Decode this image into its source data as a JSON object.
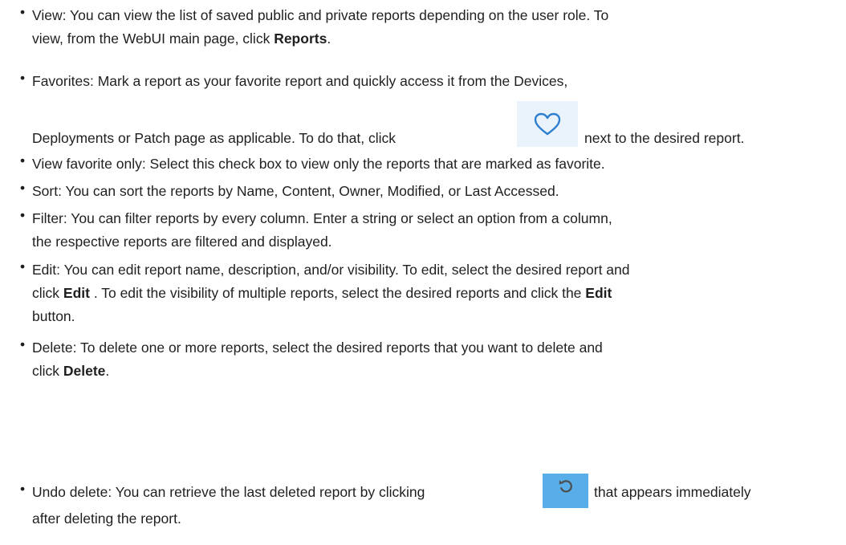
{
  "bullet_char": "•",
  "items": [
    {
      "lines": [
        [
          "View: You can view the list of saved public and private reports depending on the user role. To"
        ],
        [
          "view, from the WebUI main page, click ",
          {
            "b": "Reports"
          },
          "."
        ]
      ]
    },
    {
      "lines": [
        [
          "Favorites: Mark a report as your favorite report and quickly access it from the Devices,"
        ],
        [
          "Deployments or Patch page as applicable. To do that, click "
        ],
        [
          "next to the desired report."
        ]
      ]
    },
    {
      "lines": [
        [
          "View favorite only: Select this check box to view only the reports that are marked as favorite."
        ]
      ]
    },
    {
      "lines": [
        [
          "Sort: You can sort the reports by Name, Content, Owner, Modified, or Last Accessed."
        ]
      ]
    },
    {
      "lines": [
        [
          "Filter: You can filter reports by every column. Enter a string or select an option from a column,"
        ],
        [
          "the respective reports are filtered and displayed."
        ]
      ]
    },
    {
      "lines": [
        [
          "Edit: You can edit report name, description, and/or visibility. To edit, select the desired report and"
        ],
        [
          "click ",
          {
            "b": "Edit"
          },
          " . To edit the visibility of multiple reports, select the desired reports and click the ",
          {
            "b": "Edit"
          }
        ],
        [
          "button."
        ]
      ]
    },
    {
      "lines": [
        [
          "Delete: To delete one or more reports, select the desired reports that you want to delete and"
        ],
        [
          "click ",
          {
            "b": "Delete"
          },
          "."
        ]
      ]
    },
    {
      "lines": [
        [
          "Undo delete: You can retrieve the last deleted report by clicking "
        ],
        [
          "that appears immediately"
        ],
        [
          "after deleting the report."
        ]
      ]
    }
  ],
  "icons": {
    "favorite": "heart-icon",
    "undo": "undo-icon"
  },
  "colors": {
    "text": "#1f1f1f",
    "heart_bg": "#eaf3fb",
    "heart_stroke": "#2f7fd0",
    "undo_bg": "#58aee8",
    "undo_stroke": "#4d4d4d"
  }
}
